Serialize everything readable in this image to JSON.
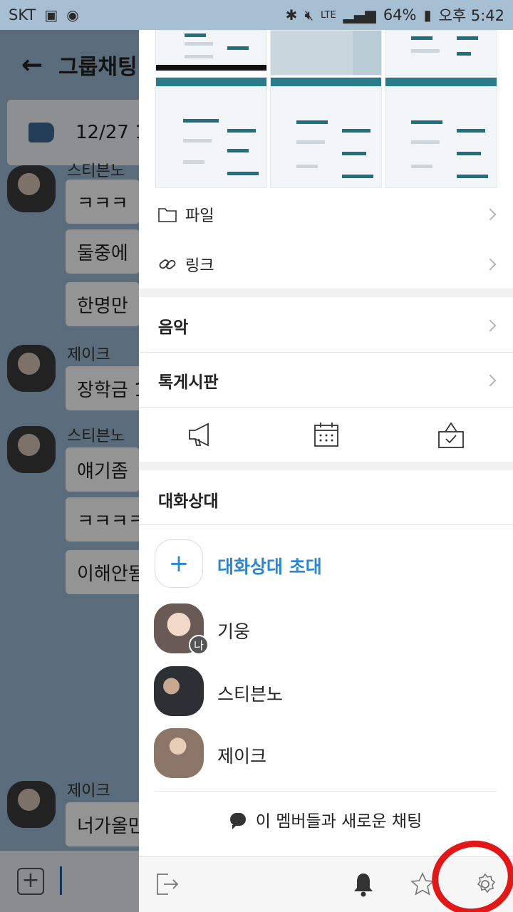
{
  "status_bar": {
    "carrier": "SKT",
    "network": "LTE",
    "battery": "64%",
    "time": "오후 5:42"
  },
  "chat": {
    "title": "그룹채팅",
    "notice_date": "12/27 1",
    "messages": [
      {
        "sender": "스티븐노",
        "text": "ㅋㅋㅋ"
      },
      {
        "sender": "",
        "text": "둘중에"
      },
      {
        "sender": "",
        "text": "한명만"
      },
      {
        "sender": "제이크",
        "text": "장학금 1"
      },
      {
        "sender": "스티븐노",
        "text": "얘기좀"
      },
      {
        "sender": "",
        "text": "ㅋㅋㅋㅋ"
      },
      {
        "sender": "",
        "text": "이해안됨"
      },
      {
        "sender": "제이크",
        "text": "너가올만"
      }
    ]
  },
  "drawer": {
    "file_label": "파일",
    "link_label": "링크",
    "music_label": "음악",
    "board_label": "톡게시판",
    "tools": [
      "megaphone-icon",
      "calendar-icon",
      "vote-icon"
    ],
    "members_title": "대화상대",
    "invite_label": "대화상대 초대",
    "me_badge": "나",
    "members": [
      {
        "name": "기웅",
        "avatar_color": "#6a5a55"
      },
      {
        "name": "스티븐노",
        "avatar_color": "#2c2f33"
      },
      {
        "name": "제이크",
        "avatar_color": "#8b7566"
      }
    ],
    "new_chat_label": "이 멤버들과 새로운 채팅",
    "bottom_bar": [
      "exit-icon",
      "bell-icon",
      "star-icon",
      "gear-icon"
    ]
  },
  "colors": {
    "accent_blue": "#2a86d0",
    "annotation_red": "#e01818"
  }
}
